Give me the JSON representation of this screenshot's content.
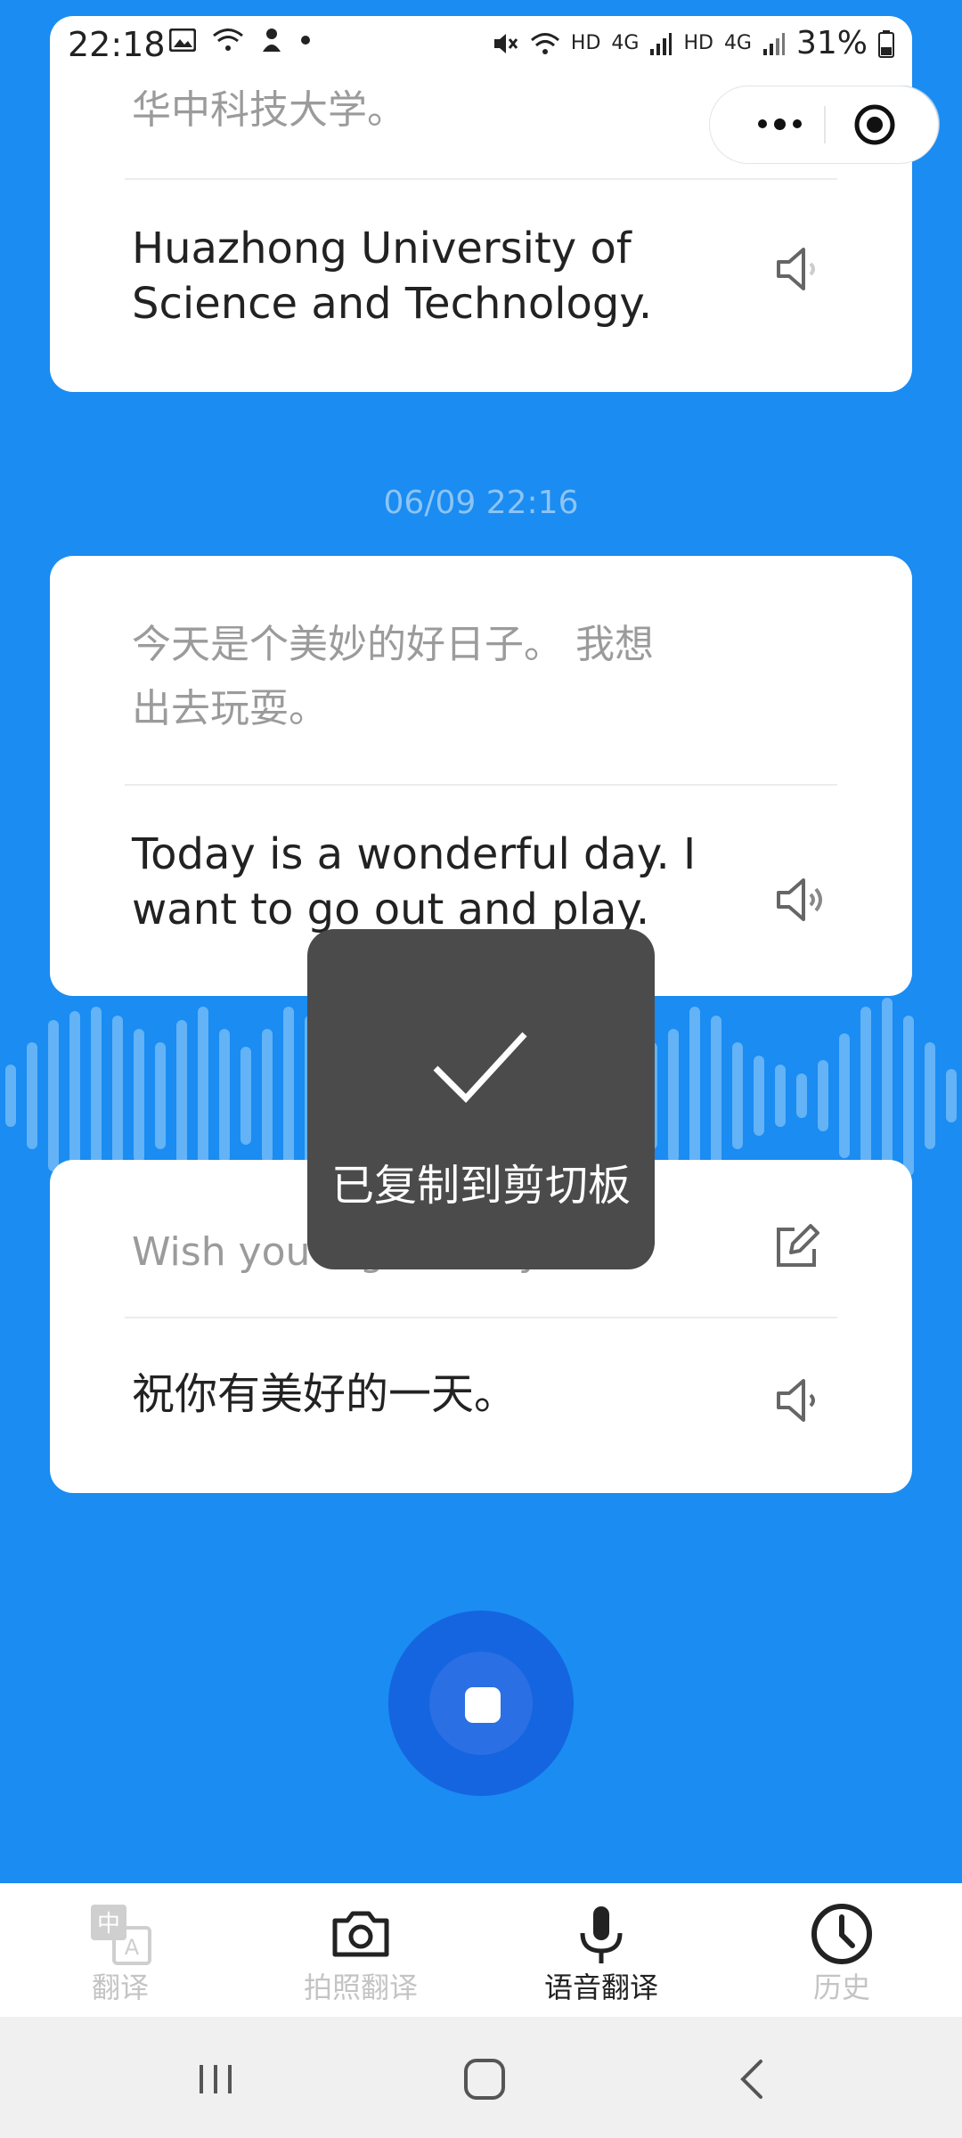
{
  "status_bar": {
    "time": "22:18",
    "hd1": "HD",
    "net1": "4G",
    "hd2": "HD",
    "net2": "4G",
    "battery": "31%"
  },
  "capsule": {
    "more_icon": "more-dots-icon",
    "close_icon": "target-icon"
  },
  "conversation": [
    {
      "source_text": "华中科技大学。",
      "target_text_line1": "Huazhong University of",
      "target_text_line2": "Science and Technology.",
      "speaker_icon": "speaker-icon"
    },
    {
      "timestamp": "06/09 22:16",
      "source_text_line1": "今天是个美妙的好日子。 我想",
      "source_text_line2": "出去玩耍。",
      "target_text_line1": "Today is a wonderful day. I",
      "target_text_line2": "want to go out and play.",
      "speaker_icon": "speaker-icon"
    },
    {
      "source_text": "Wish you a good day.",
      "edit_icon": "edit-icon",
      "target_text": "祝你有美好的一天。",
      "speaker_icon": "speaker-icon"
    }
  ],
  "toast": {
    "icon": "check-icon",
    "message": "已复制到剪切板"
  },
  "record_button": {
    "icon": "stop-icon"
  },
  "tab_bar": {
    "tabs": [
      {
        "label": "翻译",
        "icon": "translate-icon",
        "active": false
      },
      {
        "label": "拍照翻译",
        "icon": "camera-icon",
        "active": false
      },
      {
        "label": "语音翻译",
        "icon": "microphone-icon",
        "active": true
      },
      {
        "label": "历史",
        "icon": "clock-icon",
        "active": false
      }
    ]
  },
  "colors": {
    "background": "#1a8cf2",
    "toast": "#4b4b4b",
    "record": "#1565e0"
  }
}
